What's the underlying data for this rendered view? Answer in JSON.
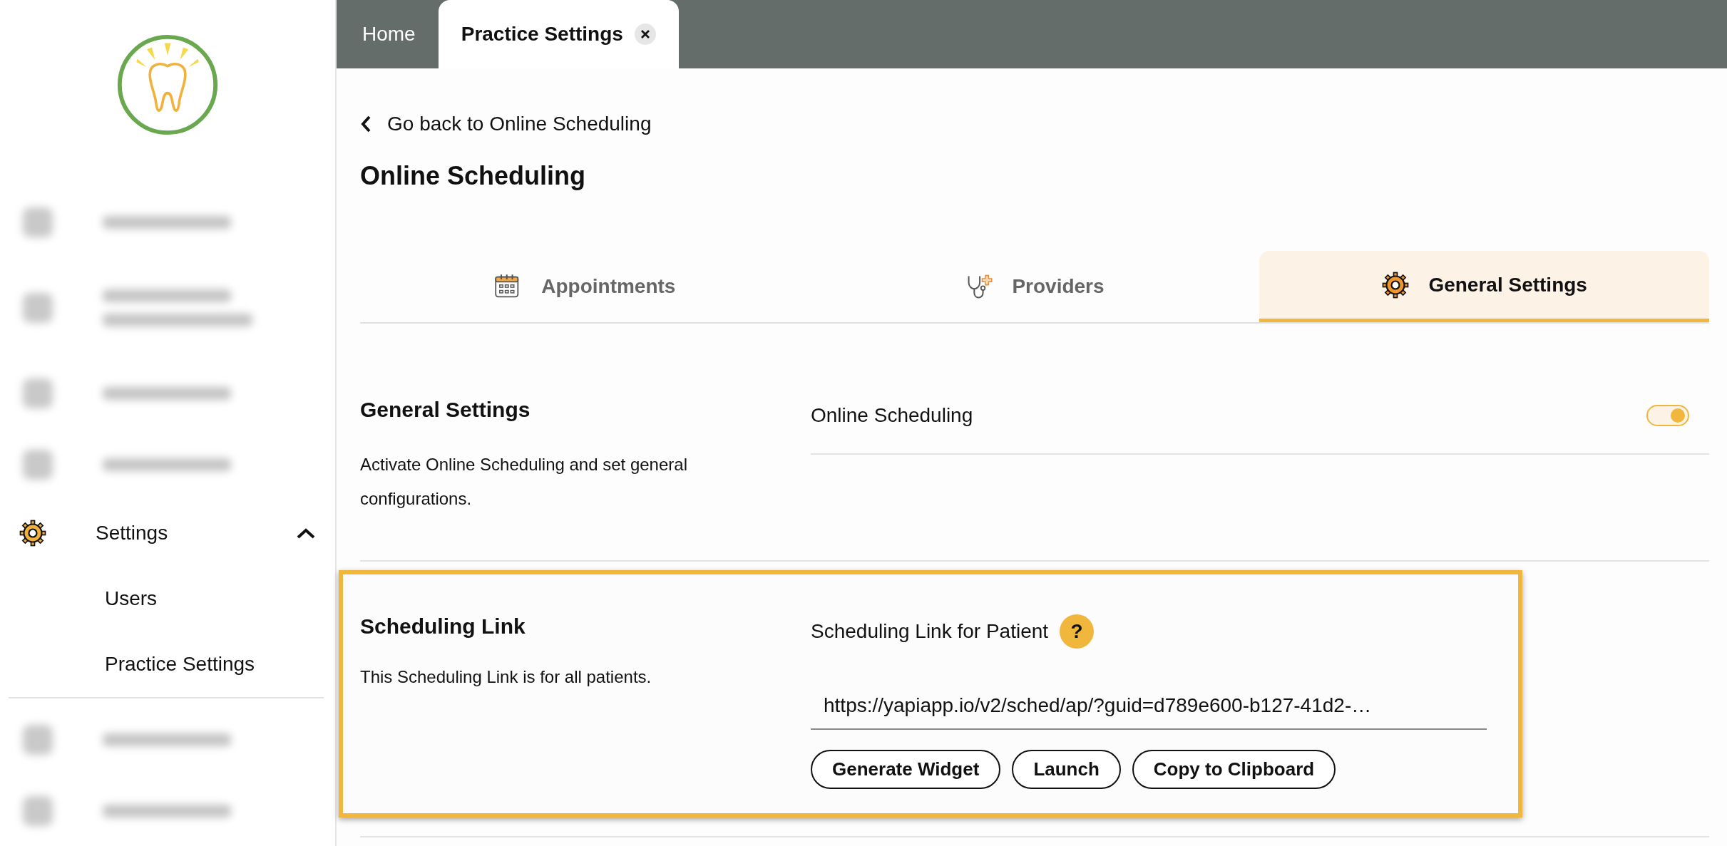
{
  "sidebar": {
    "logo": {
      "kind": "tooth"
    },
    "items": [
      {
        "kind": "blurred"
      },
      {
        "kind": "blurred_tall"
      },
      {
        "kind": "blurred"
      },
      {
        "kind": "blurred"
      },
      {
        "kind": "group",
        "label": "Settings",
        "expanded": true,
        "children": [
          {
            "label": "Users",
            "selected": false
          },
          {
            "label": "Practice Settings",
            "selected": false
          }
        ]
      },
      {
        "kind": "divider"
      },
      {
        "kind": "blurred"
      },
      {
        "kind": "blurred"
      }
    ]
  },
  "tab_bar": {
    "tabs": [
      {
        "label": "Home",
        "selected": false,
        "closable": false
      },
      {
        "label": "Practice Settings",
        "selected": true,
        "closable": true
      }
    ]
  },
  "back_link": {
    "label": "Go back to Online Scheduling"
  },
  "page_title": "Online Scheduling",
  "section_tabs": [
    {
      "label": "Appointments",
      "selected": false
    },
    {
      "label": "Providers",
      "selected": false
    },
    {
      "label": "General Settings",
      "selected": true
    }
  ],
  "sections": [
    {
      "kind": "toggle",
      "title": "General Settings",
      "description": "Activate Online Scheduling and set general configurations.",
      "highlighted": false,
      "label": "Online Scheduling",
      "on": true
    },
    {
      "kind": "link",
      "title": "Scheduling Link",
      "description": "This Scheduling Link is for all patients.",
      "highlighted": true,
      "label": "Scheduling Link for Patient",
      "help": "?",
      "value": "https://yapiapp.io/v2/sched/ap/?guid=d789e600-b127-41d2-…",
      "buttons": [
        "Generate Widget",
        "Launch",
        "Copy to Clipboard"
      ]
    }
  ]
}
